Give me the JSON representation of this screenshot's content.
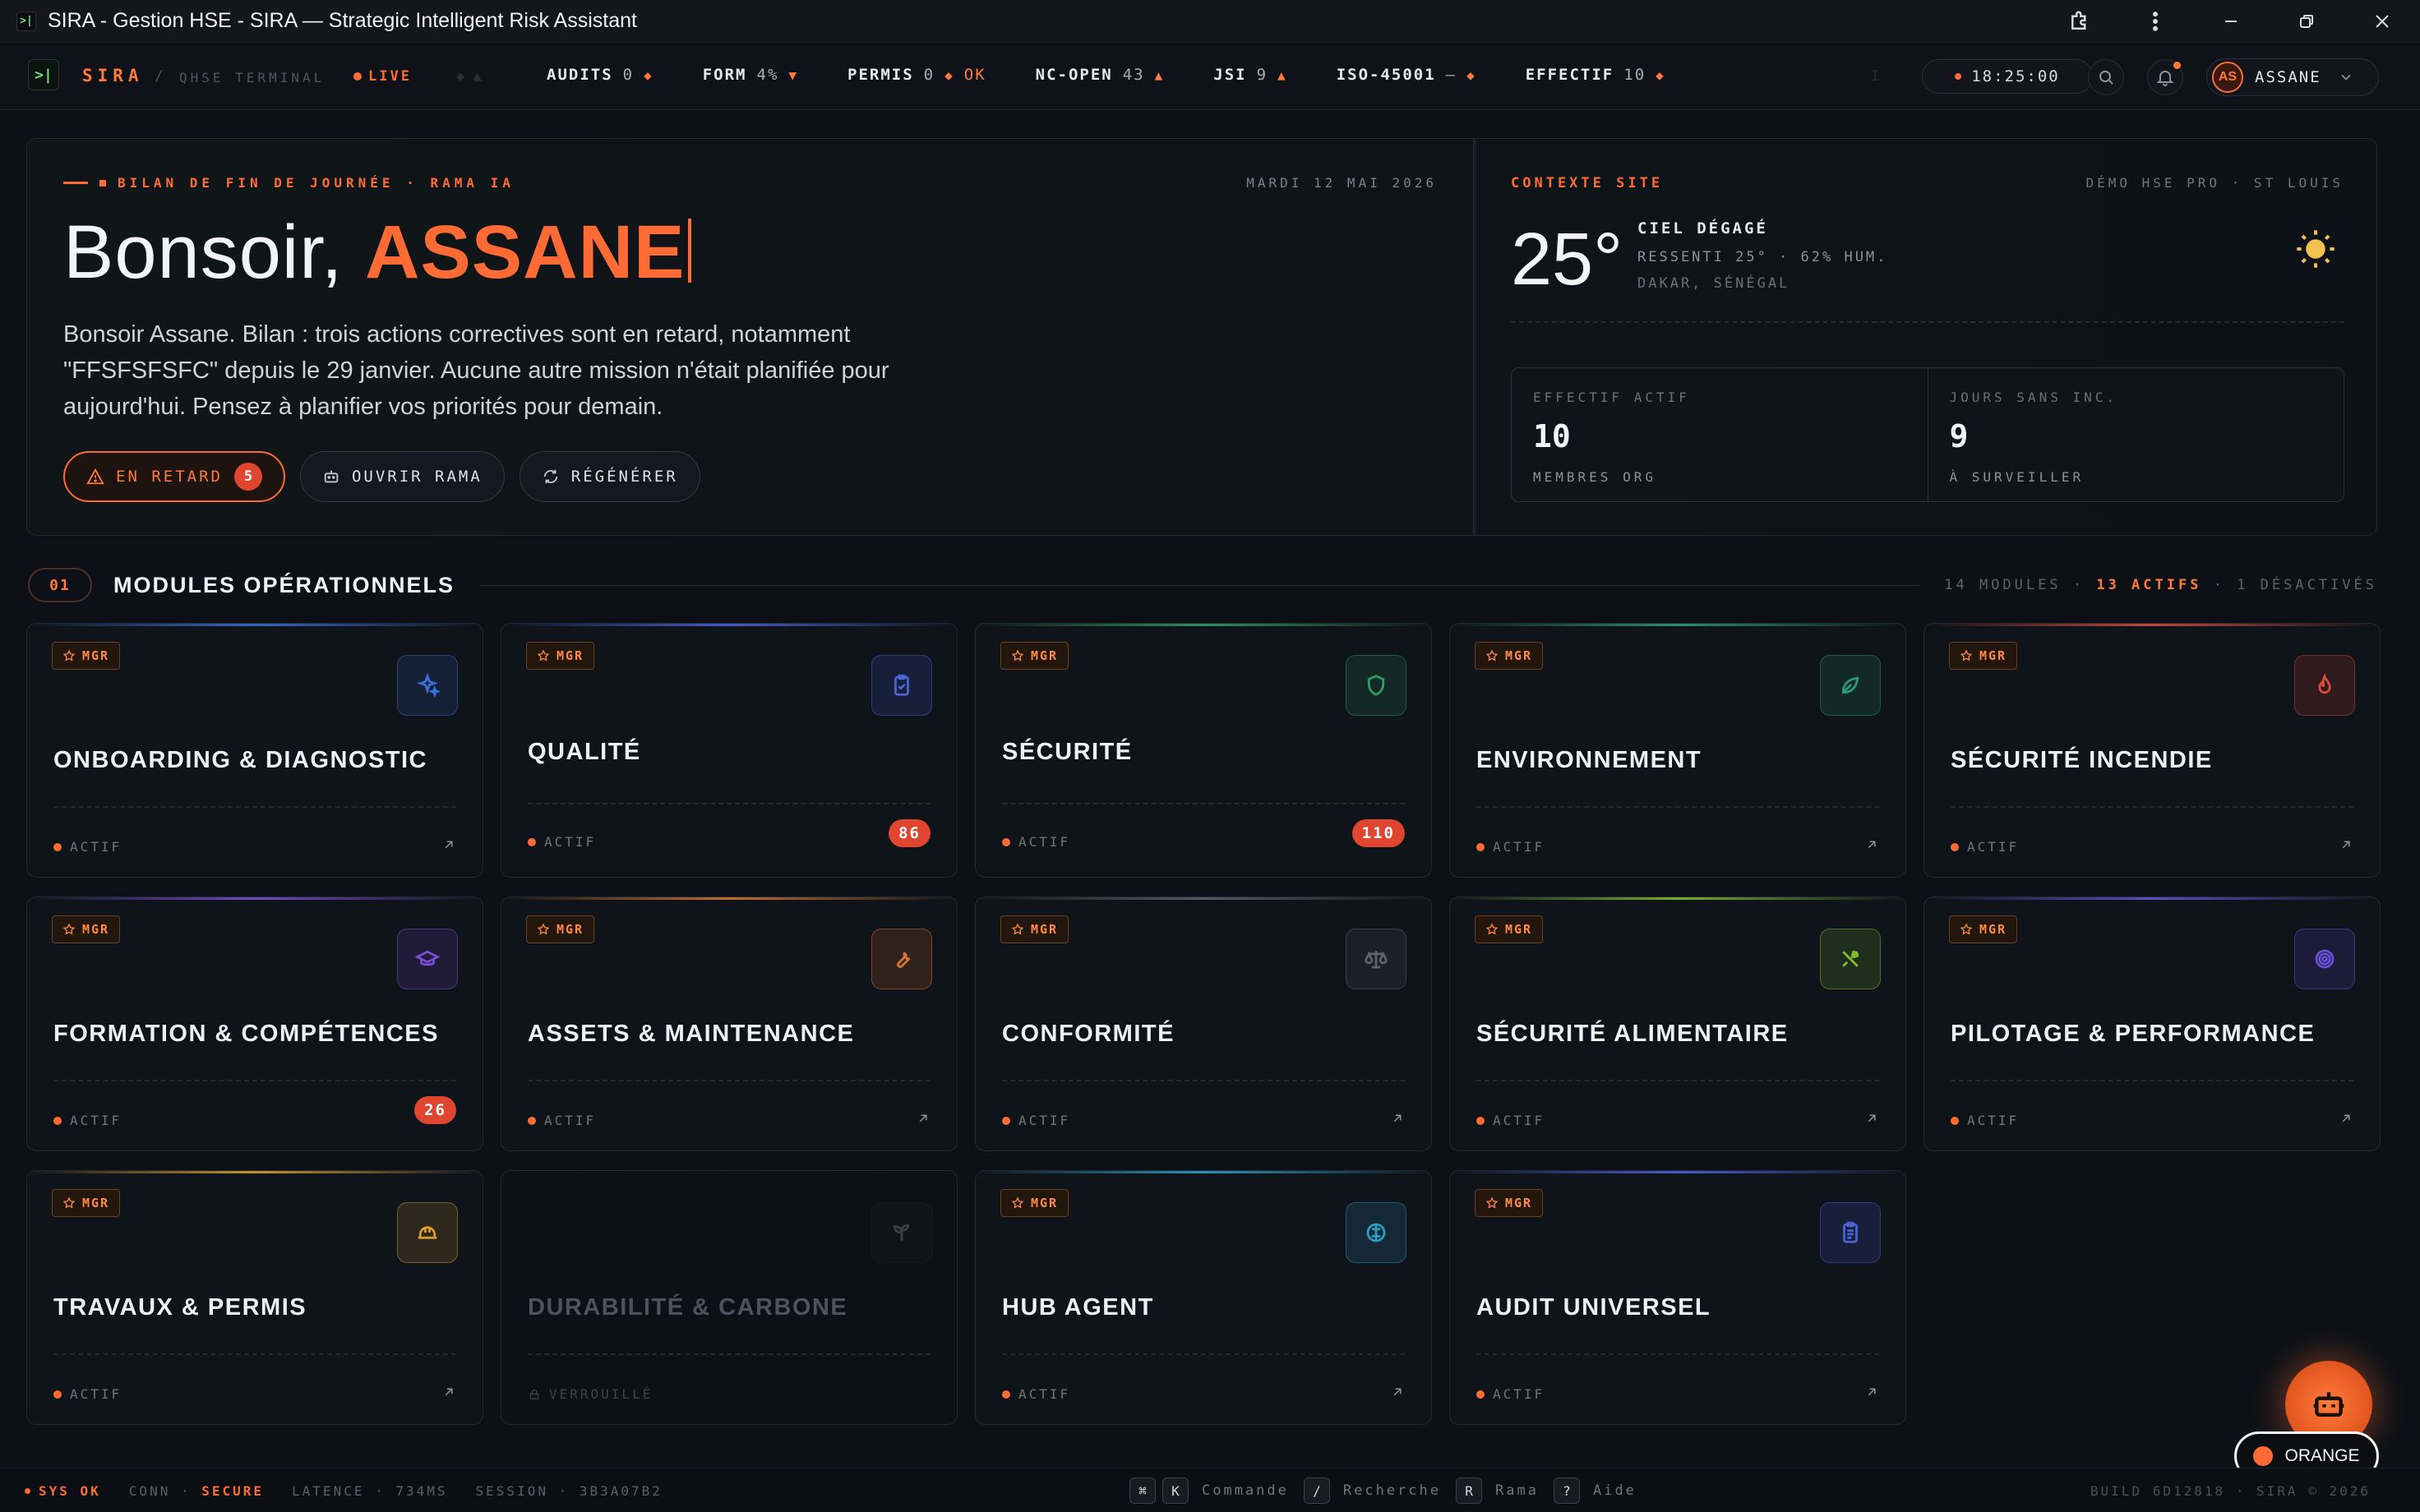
{
  "window": {
    "title": "SIRA - Gestion HSE - SIRA — Strategic Intelligent Risk Assistant"
  },
  "topbar": {
    "brand": "SIRA",
    "separator": "/",
    "subtitle": "QHSE TERMINAL",
    "live": "LIVE",
    "ticker": [
      {
        "label": "AUDITS",
        "value": "0",
        "trend": "◆",
        "extra": ""
      },
      {
        "label": "FORM",
        "value": "4%",
        "trend": "▼",
        "extra": ""
      },
      {
        "label": "PERMIS",
        "value": "0",
        "trend": "◆",
        "extra": "OK"
      },
      {
        "label": "NC-OPEN",
        "value": "43",
        "trend": "▲",
        "extra": ""
      },
      {
        "label": "JSI",
        "value": "9",
        "trend": "▲",
        "extra": ""
      },
      {
        "label": "ISO-45001",
        "value": "—",
        "trend": "◆",
        "extra": ""
      },
      {
        "label": "EFFECTIF",
        "value": "10",
        "trend": "◆",
        "extra": ""
      }
    ],
    "clock": "18:25:00",
    "user": {
      "initials": "AS",
      "name": "ASSANE"
    }
  },
  "hero": {
    "kicker": "BILAN DE FIN DE JOURNÉE · RAMA IA",
    "date": "MARDI 12 MAI 2026",
    "greeting_prefix": "Bonsoir, ",
    "greeting_name": "ASSANE",
    "summary": "Bonsoir Assane. Bilan : trois actions correctives sont en retard, notamment \"FFSFSFSFC\" depuis le 29 janvier. Aucune autre mission n'était planifiée pour aujourd'hui. Pensez à planifier vos priorités pour demain.",
    "actions": {
      "late_label": "EN RETARD",
      "late_count": "5",
      "open_label": "OUVRIR RAMA",
      "regen_label": "RÉGÉNÉRER"
    }
  },
  "context": {
    "title": "CONTEXTE SITE",
    "site": "DÉMO HSE PRO · ST LOUIS",
    "temperature": "25°",
    "sky": "CIEL DÉGAGÉ",
    "feel": "RESSENTI 25° · 62% HUM.",
    "location": "DAKAR, SÉNÉGAL",
    "weather_icon": "sun-icon",
    "stats": [
      {
        "label": "EFFECTIF ACTIF",
        "value": "10",
        "sub": "MEMBRES ORG"
      },
      {
        "label": "JOURS SANS INC.",
        "value": "9",
        "sub": "À SURVEILLER"
      }
    ]
  },
  "modules_section": {
    "number": "01",
    "title": "MODULES OPÉRATIONNELS",
    "meta_total": "14 MODULES",
    "meta_sep": " · ",
    "meta_active": "13 ACTIFS",
    "meta_disabled": "1 DÉSACTIVÉS"
  },
  "modules": [
    {
      "title": "ONBOARDING & DIAGNOSTIC",
      "badge": "MGR",
      "status": "ACTIF",
      "count": "",
      "icon": "sparkles-icon",
      "accent": "#3b6fd6"
    },
    {
      "title": "QUALITÉ",
      "badge": "MGR",
      "status": "ACTIF",
      "count": "86",
      "icon": "clipboard-check-icon",
      "accent": "#4a63d8"
    },
    {
      "title": "SÉCURITÉ",
      "badge": "MGR",
      "status": "ACTIF",
      "count": "110",
      "icon": "shield-icon",
      "accent": "#2f9e62"
    },
    {
      "title": "ENVIRONNEMENT",
      "badge": "MGR",
      "status": "ACTIF",
      "count": "",
      "icon": "leaf-icon",
      "accent": "#2b9c77"
    },
    {
      "title": "SÉCURITÉ INCENDIE",
      "badge": "MGR",
      "status": "ACTIF",
      "count": "",
      "icon": "flame-icon",
      "accent": "#d84a3a"
    },
    {
      "title": "FORMATION & COMPÉTENCES",
      "badge": "MGR",
      "status": "ACTIF",
      "count": "26",
      "icon": "graduation-cap-icon",
      "accent": "#7b4fd8"
    },
    {
      "title": "ASSETS & MAINTENANCE",
      "badge": "MGR",
      "status": "ACTIF",
      "count": "",
      "icon": "wrench-icon",
      "accent": "#d8762f"
    },
    {
      "title": "CONFORMITÉ",
      "badge": "MGR",
      "status": "ACTIF",
      "count": "",
      "icon": "scale-icon",
      "accent": "#5b6270"
    },
    {
      "title": "SÉCURITÉ ALIMENTAIRE",
      "badge": "MGR",
      "status": "ACTIF",
      "count": "",
      "icon": "utensils-icon",
      "accent": "#7fbf2f"
    },
    {
      "title": "PILOTAGE & PERFORMANCE",
      "badge": "MGR",
      "status": "ACTIF",
      "count": "",
      "icon": "target-icon",
      "accent": "#6a4fd8"
    },
    {
      "title": "TRAVAUX & PERMIS",
      "badge": "MGR",
      "status": "ACTIF",
      "count": "",
      "icon": "hard-hat-icon",
      "accent": "#d8a02f"
    },
    {
      "title": "DURABILITÉ & CARBONE",
      "badge": "",
      "status": "VERROUILLÉ",
      "count": "",
      "icon": "sprout-icon",
      "accent": "#2a2f38"
    },
    {
      "title": "HUB AGENT",
      "badge": "MGR",
      "status": "ACTIF",
      "count": "",
      "icon": "brain-icon",
      "accent": "#2f9ec4"
    },
    {
      "title": "AUDIT UNIVERSEL",
      "badge": "MGR",
      "status": "ACTIF",
      "count": "",
      "icon": "clipboard-list-icon",
      "accent": "#4a63d8"
    }
  ],
  "fab": {
    "icon": "bot-icon",
    "theme_label": "ORANGE"
  },
  "statusbar": {
    "sys": "SYS OK",
    "conn": "CONN · ",
    "conn_value": "SECURE",
    "latency": "LATENCE · 734MS",
    "session": "SESSION · 3B3A07B2",
    "shortcuts": [
      {
        "keys": [
          "⌘",
          "K"
        ],
        "label": "Commande"
      },
      {
        "keys": [
          "/"
        ],
        "label": "Recherche"
      },
      {
        "keys": [
          "R"
        ],
        "label": "Rama"
      },
      {
        "keys": [
          "?"
        ],
        "label": "Aide"
      }
    ],
    "build": "BUILD 6D12818 · SIRA © 2026"
  },
  "colors": {
    "accent": "#ff6b35",
    "background": "#0d1117",
    "danger_badge": "#e0452f"
  }
}
